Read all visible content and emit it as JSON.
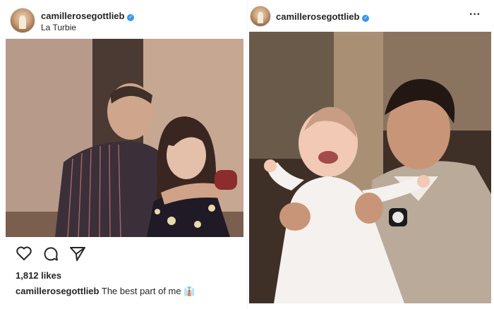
{
  "left_post": {
    "username": "camillerosegottlieb",
    "location": "La Turbie",
    "likes": "1,812 likes",
    "caption_user": "camillerosegottlieb",
    "caption_text": "The best part of me",
    "caption_emoji": "👔"
  },
  "right_post": {
    "username": "camillerosegottlieb",
    "more": "···"
  },
  "icons": {
    "verified": "verified-badge-icon",
    "like": "heart-icon",
    "comment": "comment-icon",
    "share": "send-icon",
    "more": "more-icon"
  },
  "colors": {
    "text": "#262626",
    "verified_blue": "#3897f0",
    "background": "#ffffff"
  }
}
